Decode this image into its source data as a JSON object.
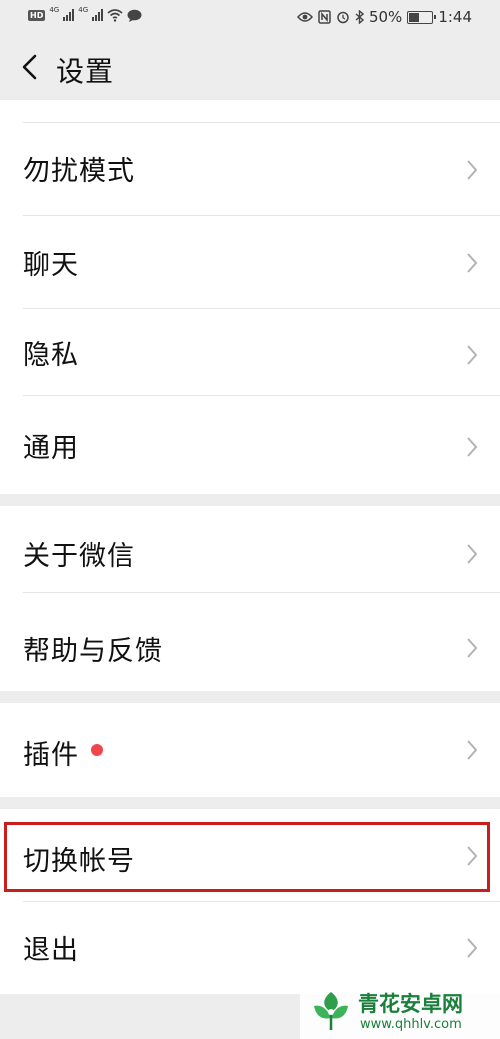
{
  "status_bar": {
    "hd_label": "HD",
    "net_1": "4G",
    "net_2": "4G",
    "battery_percent": "50%",
    "time": "1:44"
  },
  "header": {
    "title": "设置"
  },
  "groups": [
    {
      "items": [
        {
          "label": "勿扰模式"
        },
        {
          "label": "聊天"
        },
        {
          "label": "隐私"
        },
        {
          "label": "通用"
        }
      ]
    },
    {
      "items": [
        {
          "label": "关于微信"
        },
        {
          "label": "帮助与反馈"
        }
      ]
    },
    {
      "items": [
        {
          "label": "插件",
          "badge": "red-dot"
        }
      ]
    },
    {
      "items": [
        {
          "label": "切换帐号",
          "highlighted": true
        },
        {
          "label": "退出"
        }
      ]
    }
  ],
  "colors": {
    "background": "#ededed",
    "row_bg": "#ffffff",
    "badge_red": "#f0454b",
    "highlight_border": "#c81e1e",
    "watermark_green": "#1a7f3a"
  },
  "watermark": {
    "title": "青花安卓网",
    "url": "www.qhhlv.com"
  }
}
